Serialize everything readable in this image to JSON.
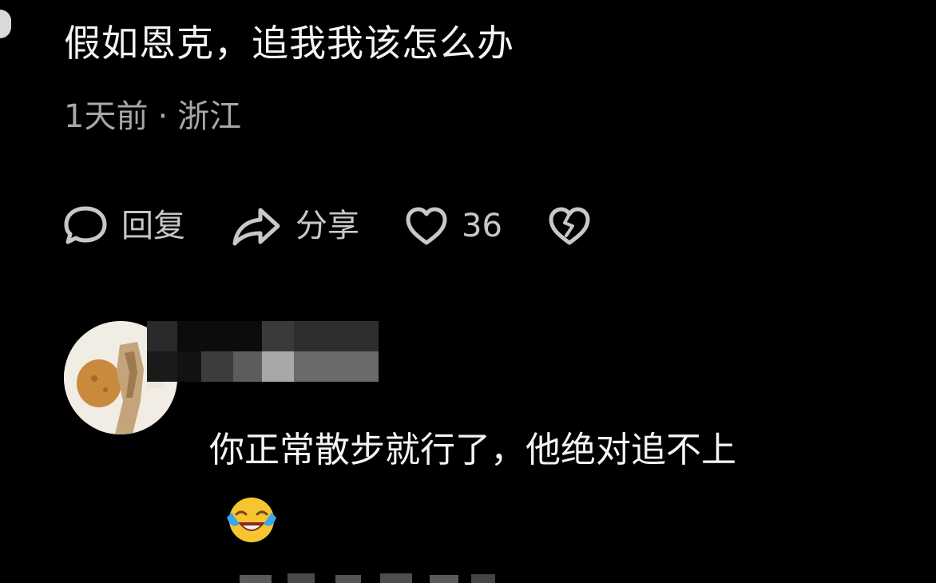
{
  "post": {
    "title": "假如恩克，追我我该怎么办",
    "time": "1天前",
    "separator": "·",
    "location": "浙江"
  },
  "actions": {
    "reply_label": "回复",
    "share_label": "分享",
    "like_count": "36",
    "icons": [
      "comment-bubble-icon",
      "share-arrow-icon",
      "heart-icon",
      "broken-heart-icon"
    ]
  },
  "comment": {
    "text": "你正常散步就行了，他绝对追不上",
    "emoji": "laughing-crying-emoji"
  },
  "colors": {
    "background": "#000000",
    "text_primary": "#f4f4f4",
    "text_secondary": "#a7a7a7",
    "icon": "#c8c8c8"
  }
}
